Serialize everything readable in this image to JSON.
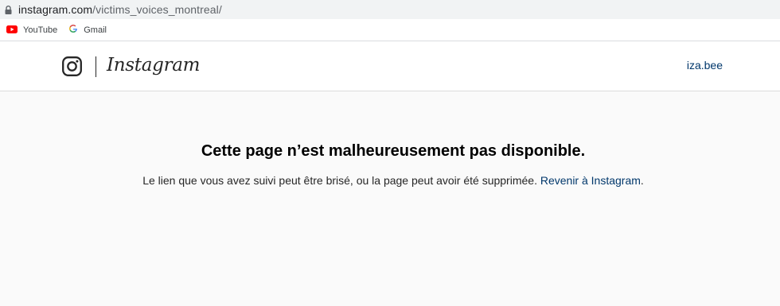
{
  "browser": {
    "url_domain": "instagram.com",
    "url_path": "/victims_voices_montreal/",
    "bookmarks": [
      {
        "label": "YouTube",
        "icon": "youtube-icon"
      },
      {
        "label": "Gmail",
        "icon": "google-icon"
      }
    ]
  },
  "header": {
    "logo_text": "Instagram",
    "username": "iza.bee"
  },
  "main": {
    "error_title": "Cette page n’est malheureusement pas disponible.",
    "error_message": "Le lien que vous avez suivi peut être brisé, ou la page peut avoir été supprimée.",
    "back_link": "Revenir à Instagram",
    "back_link_suffix": "."
  },
  "colors": {
    "link": "#00376b",
    "page_background": "#fafafa",
    "youtube_red": "#ff0000"
  }
}
